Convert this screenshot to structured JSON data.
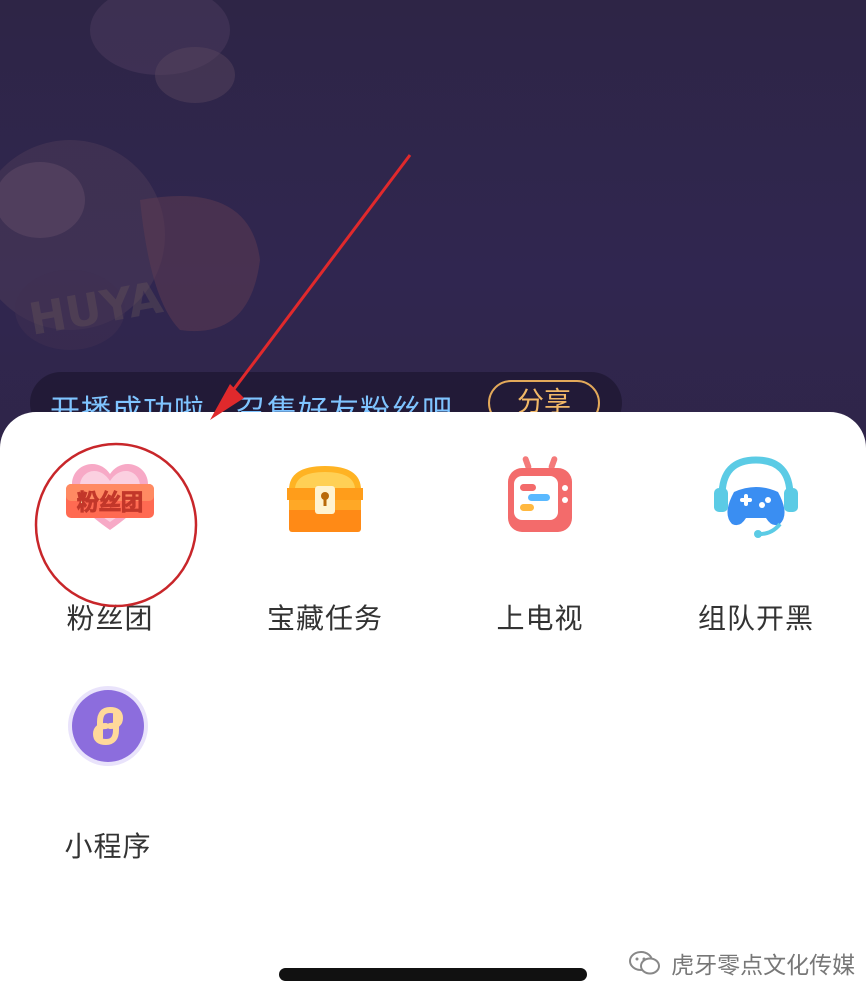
{
  "banner": {
    "message": "开播成功啦，召集好友粉丝吧",
    "share_label": "分享"
  },
  "menu": {
    "items": [
      {
        "label": "粉丝团",
        "icon": "fan-club-icon",
        "badge_text": "粉丝团"
      },
      {
        "label": "宝藏任务",
        "icon": "treasure-chest-icon"
      },
      {
        "label": "上电视",
        "icon": "tv-icon"
      },
      {
        "label": "组队开黑",
        "icon": "gamepad-icon"
      },
      {
        "label": "小程序",
        "icon": "mini-program-icon"
      }
    ]
  },
  "watermark": {
    "text": "虎牙零点文化传媒"
  },
  "colors": {
    "background": "#2e2546",
    "banner_text": "#7fc4ff",
    "share_border": "#e3a95a",
    "annotation": "#e0292c",
    "sheet": "#ffffff"
  }
}
